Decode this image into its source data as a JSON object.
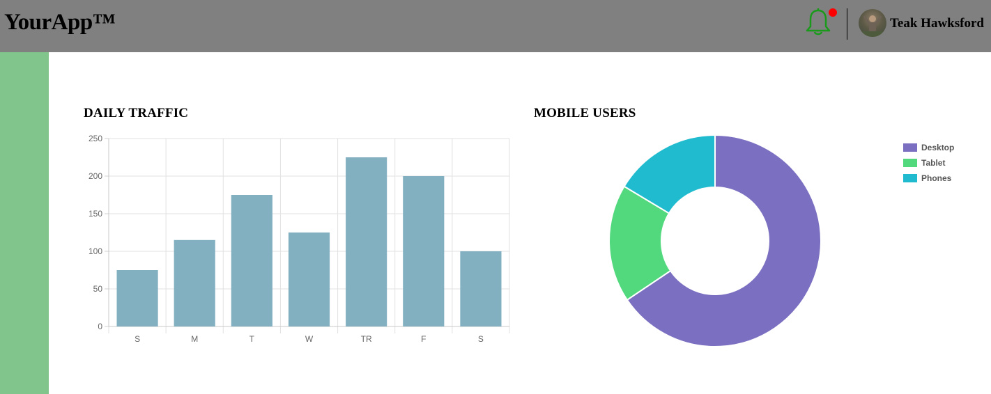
{
  "header": {
    "logo": "YourApp™",
    "user_name": "Teak Hawksford",
    "has_notification": true
  },
  "colors": {
    "header_bg": "#808080",
    "sidebar_bg": "#81c58c",
    "bell": "#1a9a1a",
    "notification_dot": "#ff0000",
    "bar_fill": "#82b0c1"
  },
  "traffic": {
    "title": "DAILY TRAFFIC"
  },
  "mobile": {
    "title": "MOBILE USERS"
  },
  "chart_data": [
    {
      "type": "bar",
      "title": "DAILY TRAFFIC",
      "categories": [
        "S",
        "M",
        "T",
        "W",
        "TR",
        "F",
        "S"
      ],
      "values": [
        75,
        115,
        175,
        125,
        225,
        200,
        100
      ],
      "ylim": [
        0,
        250
      ],
      "yticks": [
        "0",
        "50",
        "100",
        "150",
        "200",
        "250"
      ],
      "grid": true,
      "color": "#82b0c1"
    },
    {
      "type": "pie",
      "variant": "donut",
      "title": "MOBILE USERS",
      "labels": [
        "Desktop",
        "Tablet",
        "Phones"
      ],
      "values": [
        2000,
        550,
        500
      ],
      "colors": [
        "#7a6fc1",
        "#52d97e",
        "#20bbcf"
      ],
      "legend_position": "right"
    }
  ]
}
